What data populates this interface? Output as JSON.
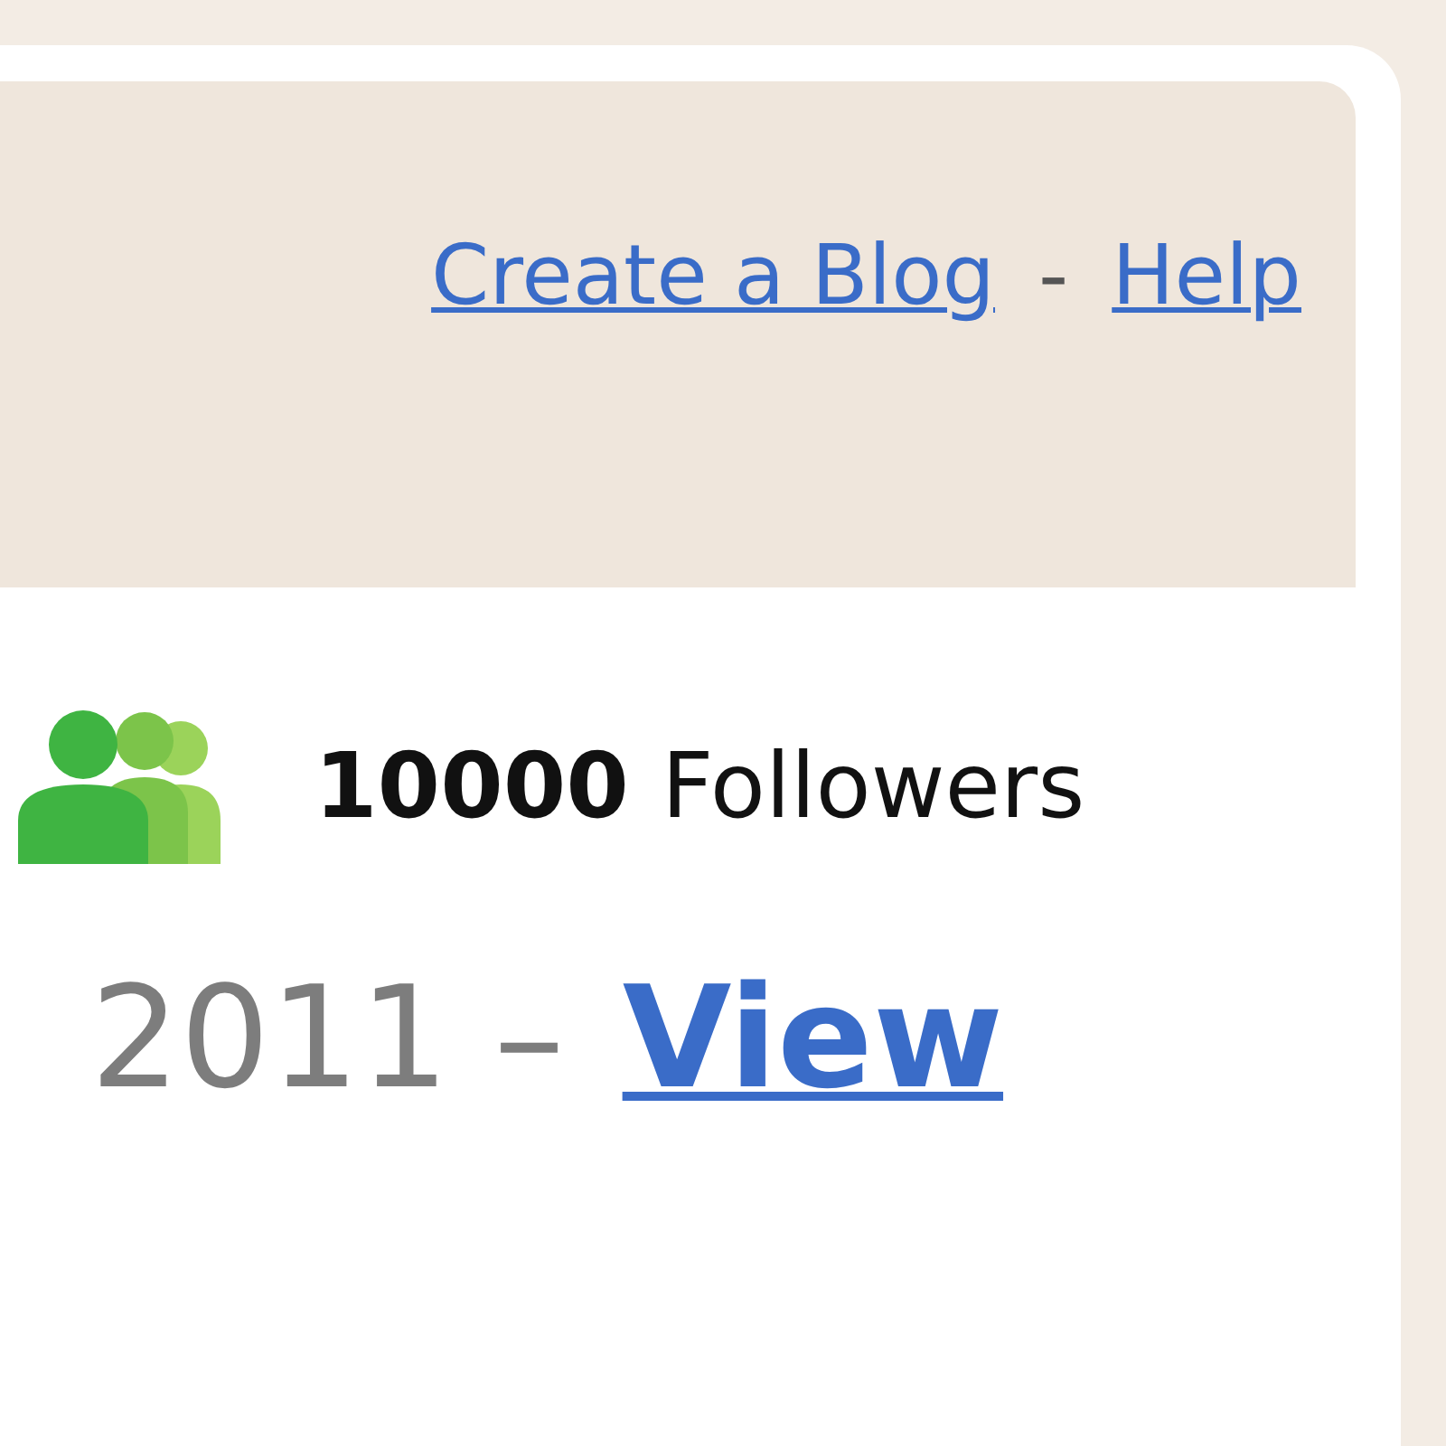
{
  "header_links": [
    {
      "label": "Create a Blog"
    },
    {
      "label": "Help"
    }
  ],
  "separator": "-",
  "followers": {
    "count": "10000",
    "label": "Followers"
  },
  "post_date": {
    "text": "2011 –",
    "link": "View"
  }
}
